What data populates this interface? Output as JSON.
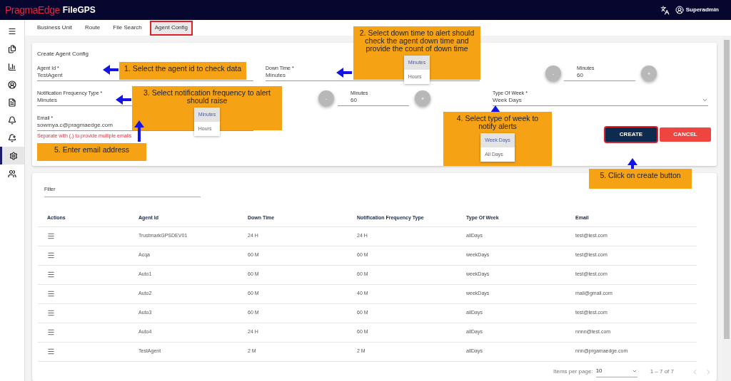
{
  "app": {
    "brand": "PragmaEdge",
    "product": "FileGPS",
    "user": "Superadmin"
  },
  "sidebar": {
    "items": [
      {
        "selected": false
      },
      {
        "selected": false
      },
      {
        "selected": false
      },
      {
        "selected": false
      },
      {
        "selected": false
      },
      {
        "selected": false
      },
      {
        "selected": false
      },
      {
        "selected": true
      },
      {
        "selected": false
      }
    ]
  },
  "tabs": [
    {
      "label": "Business Unit",
      "selected": false,
      "highlighted": false
    },
    {
      "label": "Route",
      "selected": false,
      "highlighted": false
    },
    {
      "label": "File Search",
      "selected": false,
      "highlighted": false
    },
    {
      "label": "Agent Config",
      "selected": true,
      "highlighted": true
    }
  ],
  "form": {
    "title": "Create Agent Config",
    "agent_id": {
      "label": "Agent Id *",
      "value": "TestAgent"
    },
    "down_time": {
      "label": "Down Time *",
      "value": "Minutes"
    },
    "down_time_count": {
      "label": "Minutes",
      "value": "60",
      "minus": "-",
      "plus": "+"
    },
    "notification_frequency_type": {
      "label": "Notification Frequency Type *",
      "value": "Minutes"
    },
    "notification_count": {
      "label": "Minutes",
      "value": "60",
      "minus": "-",
      "plus": "+"
    },
    "type_of_week": {
      "label": "Type Of Week *",
      "value": "Week Days"
    },
    "email": {
      "label": "Email *",
      "value": "sowmya.c@pragmaedge.com",
      "hint": "Separate with (,) to provide multiple emails"
    },
    "buttons": [
      {
        "label": "CREATE",
        "kind": "primary",
        "highlighted": true
      },
      {
        "label": "CANCEL",
        "kind": "danger",
        "highlighted": false
      }
    ]
  },
  "annotations": [
    {
      "text": "1. Select the agent id to check data"
    },
    {
      "text": "2. Select down time to alert should check the agent down time and provide the count of down time",
      "options": [
        {
          "label": "Minutes",
          "selected": true
        },
        {
          "label": "Hours",
          "selected": false
        }
      ]
    },
    {
      "text": "3. Select notification frequency to alert should raise",
      "options": [
        {
          "label": "Minutes",
          "selected": true
        },
        {
          "label": "Hours",
          "selected": false
        }
      ]
    },
    {
      "text": "4. Select type of week to notify alerts",
      "options": [
        {
          "label": "Week Days",
          "selected": true
        },
        {
          "label": "All Days",
          "selected": false
        }
      ]
    },
    {
      "text": "5. Enter email address"
    },
    {
      "text": "5. Click on create button"
    }
  ],
  "table": {
    "filter_label": "Filter",
    "columns": [
      "Actions",
      "Agent Id",
      "Down Time",
      "Notification Frequency Type",
      "Type Of Week",
      "Email"
    ],
    "rows": [
      [
        "",
        "TrustmarkGPSDEV01",
        "24 H",
        "24 H",
        "allDays",
        "test@test.com"
      ],
      [
        "",
        "Acqa",
        "60 M",
        "60 M",
        "weekDays",
        "test@test.com"
      ],
      [
        "",
        "Auto1",
        "60 M",
        "60 M",
        "weekDays",
        "test@test.com"
      ],
      [
        "",
        "Auto2",
        "60 M",
        "40 M",
        "weekDays",
        "mail@gmail.com"
      ],
      [
        "",
        "Auto3",
        "60 M",
        "60 M",
        "allDays",
        "test@test.com"
      ],
      [
        "",
        "Auto4",
        "24 H",
        "60 M",
        "allDays",
        "nnnn@test.com"
      ],
      [
        "",
        "TestAgent",
        "2 M",
        "2 M",
        "allDays",
        "nnn@prgamaedge.com"
      ]
    ],
    "paginator": {
      "label": "Items per page:",
      "page_size": "10",
      "range": "1 – 7 of 7"
    }
  }
}
